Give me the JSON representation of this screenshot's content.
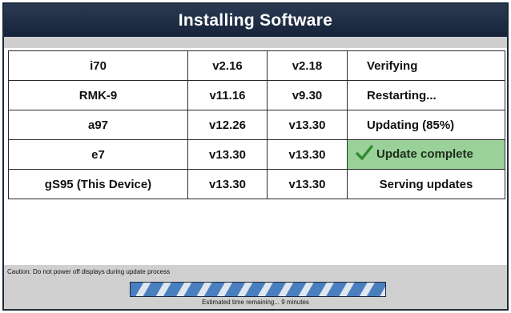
{
  "window": {
    "title": "Installing Software"
  },
  "devices": [
    {
      "name": "i70",
      "current_version": "v2.16",
      "target_version": "v2.18",
      "status": "Verifying"
    },
    {
      "name": "RMK-9",
      "current_version": "v11.16",
      "target_version": "v9.30",
      "status": "Restarting..."
    },
    {
      "name": "a97",
      "current_version": "v12.26",
      "target_version": "v13.30",
      "status": "Updating (85%)"
    },
    {
      "name": "e7",
      "current_version": "v13.30",
      "target_version": "v13.30",
      "status": "Update complete",
      "status_icon": "checkmark-icon"
    },
    {
      "name": "gS95 (This Device)",
      "current_version": "v13.30",
      "target_version": "v13.30",
      "status": "Serving updates"
    }
  ],
  "footer": {
    "caution": "Caution: Do not power off displays during update process",
    "progress_fraction": 1.0,
    "estimate": "Estimated time remaining... 9 minutes"
  },
  "colors": {
    "complete_bg": "#99d199",
    "check": "#2e8b2e",
    "title_bg": "#1f2d44",
    "progress_stripe": "#4a7fbf"
  }
}
